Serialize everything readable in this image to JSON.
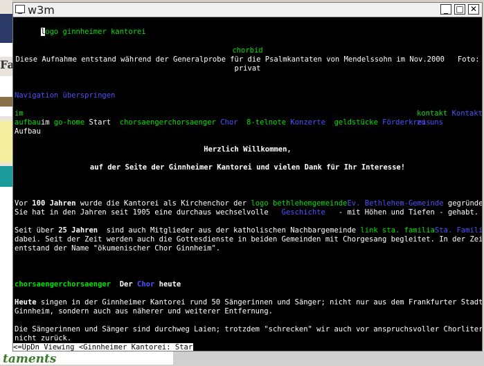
{
  "window": {
    "title": "w3m"
  },
  "background": {
    "edge_fragment": "Fag",
    "bottom_word": "taments"
  },
  "content": {
    "logo_first": "l",
    "logo_rest": "ogo ginnheimer kantorei",
    "chorbid": "chorbid",
    "caption_line1": "Diese Aufnahme entstand während der Generalprobe für die Psalmkantaten von Mendelssohn im Nov.2000   Foto:",
    "caption_line2": "privat",
    "skip_nav": "Navigation überspringen",
    "nav": {
      "im": "im",
      "aufbau_prefix": "aufbau",
      "aufbau_im": "im",
      "go_home": "go-home",
      "start": "Start",
      "chorsaenger_img": "chorsaengerchorsaenger",
      "chor": "Chor",
      "telnote": "8-telnote",
      "konzerte": "Konzerte",
      "geldstuecke": "geldstücke",
      "foerderkreis": "Förderkreis",
      "kontakt_img": "kontakt",
      "kontakt": "Kontakt",
      "zu_uns": "zu uns",
      "aufbau_word": "Aufbau"
    },
    "welcome": "Herzlich Willkommen,",
    "welcome_sub": "auf der Seite der Ginnheimer Kantorei und vielen Dank für Ihr Interesse!",
    "p1": {
      "a": "Vor ",
      "b": "100 Jahren",
      "c": " wurde die Kantorei als Kirchenchor der ",
      "d": "logo bethlehemgemeinde",
      "e": "Ev. Bethlehem-Gemeinde",
      "f": " gegründet.",
      "g": "Sie hat in den Jahren seit 1905 eine durchaus wechselvolle   ",
      "h": "Geschichte",
      "i": "   - mit Höhen und Tiefen - gehabt."
    },
    "p2": {
      "a": "Seit über ",
      "b": "25 Jahren",
      "c": "  sind auch Mitglieder aus der katholischen Nachbargemeinde ",
      "d": "link sta. familia",
      "e": "Sta. Familia",
      "line2": "dabei. Seit der Zeit werden auch die Gottesdienste in beiden Gemeinden mit Chorgesang begleitet. In der Zeit",
      "line3": "entstand der Name \"ökumenischer Chor Ginnheim\"."
    },
    "heading": {
      "img": "chorsaengerchorsaenger",
      "der": "  Der ",
      "chor": "Chor",
      "heute": " heute"
    },
    "p3": {
      "a": "Heute",
      "b": " singen in der Ginnheimer Kantorei rund 50 Sängerinnen und Sänger; nicht nur aus dem Frankfurter Stadtteil",
      "line2": "Ginnheim, sondern auch aus näherer und weiterer Entfernung."
    },
    "p4": {
      "line1": "Die Sängerinnen und Sänger sind durchweg Laien; trotzdem \"schrecken\" wir auch vor anspruchsvoller Chorliteratur",
      "line2": "nicht zurück."
    },
    "status": "<=UpDn Viewing <Ginnheimer Kantorei: Start>"
  },
  "colors": {
    "link": "#5050ff",
    "image_alt": "#00e000",
    "text": "#ffffff",
    "background": "#000000"
  }
}
